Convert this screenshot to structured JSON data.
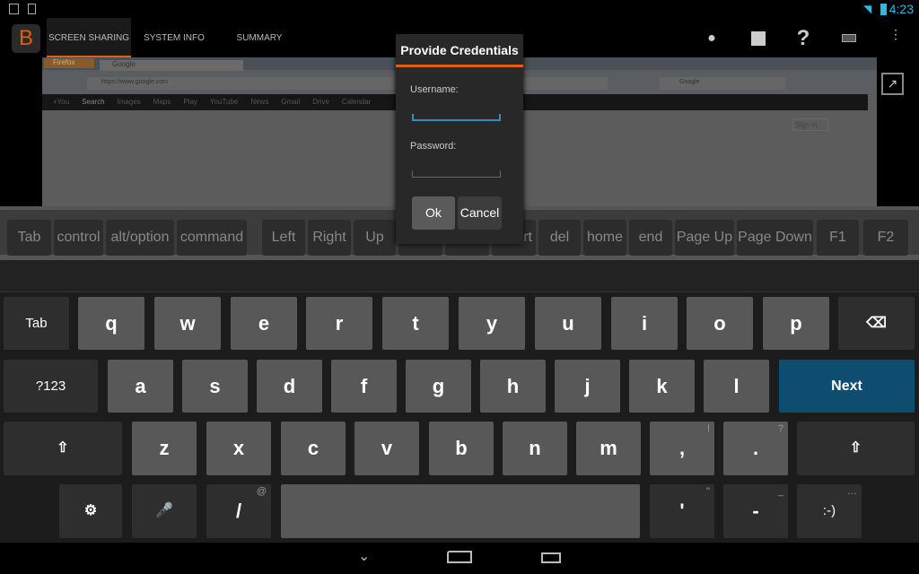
{
  "status_bar": {
    "time": "4:23",
    "icons": [
      "picture-icon",
      "download-icon",
      "wifi-icon",
      "battery-icon"
    ]
  },
  "action_bar": {
    "app_logo": "B",
    "tabs": [
      {
        "label": "SCREEN SHARING",
        "active": true
      },
      {
        "label": "SYSTEM INFO",
        "active": false
      },
      {
        "label": "SUMMARY",
        "active": false
      }
    ],
    "actions": [
      "chat-icon",
      "stop-icon",
      "help-icon",
      "keyboard-icon",
      "overflow-menu-icon"
    ]
  },
  "remote_screen": {
    "browser_button": "Firefox",
    "tab_title": "Google",
    "url": "https://www.google.com",
    "search_placeholder": "Google",
    "nav_links": [
      "+You",
      "Search",
      "Images",
      "Maps",
      "Play",
      "YouTube",
      "News",
      "Gmail",
      "Drive",
      "Calendar"
    ],
    "sign_in": "Sign in"
  },
  "extra_keys": [
    "Tab",
    "control",
    "alt/option",
    "command",
    "Left",
    "Right",
    "Up",
    "",
    "",
    "rt",
    "del",
    "home",
    "end",
    "Page Up",
    "Page Down",
    "F1",
    "F2"
  ],
  "dialog": {
    "title": "Provide Credentials",
    "username_label": "Username:",
    "username_value": "",
    "password_label": "Password:",
    "password_value": "",
    "ok": "Ok",
    "cancel": "Cancel"
  },
  "keyboard": {
    "rows": [
      [
        {
          "l": "Tab",
          "t": "dark"
        },
        {
          "l": "q"
        },
        {
          "l": "w"
        },
        {
          "l": "e"
        },
        {
          "l": "r"
        },
        {
          "l": "t"
        },
        {
          "l": "y"
        },
        {
          "l": "u"
        },
        {
          "l": "i"
        },
        {
          "l": "o"
        },
        {
          "l": "p"
        },
        {
          "l": "⌫",
          "t": "dark",
          "n": "backspace"
        }
      ],
      [
        {
          "l": "?123",
          "t": "dark"
        },
        {
          "l": "a"
        },
        {
          "l": "s"
        },
        {
          "l": "d"
        },
        {
          "l": "f"
        },
        {
          "l": "g"
        },
        {
          "l": "h"
        },
        {
          "l": "j"
        },
        {
          "l": "k"
        },
        {
          "l": "l"
        },
        {
          "l": "Next",
          "t": "accent"
        }
      ],
      [
        {
          "l": "⇧",
          "t": "dark",
          "n": "shift"
        },
        {
          "l": "z"
        },
        {
          "l": "x"
        },
        {
          "l": "c"
        },
        {
          "l": "v"
        },
        {
          "l": "b"
        },
        {
          "l": "n"
        },
        {
          "l": "m"
        },
        {
          "l": ",",
          "h": "!"
        },
        {
          "l": ".",
          "h": "?"
        },
        {
          "l": "⇧",
          "t": "dark",
          "n": "shift"
        }
      ],
      [
        {
          "l": "⚙",
          "t": "dark",
          "n": "settings"
        },
        {
          "l": "🎤",
          "t": "dark",
          "n": "mic"
        },
        {
          "l": "/",
          "t": "dark",
          "h": "@"
        },
        {
          "l": "",
          "n": "space"
        },
        {
          "l": "'",
          "t": "dark",
          "h": "\""
        },
        {
          "l": "-",
          "t": "dark",
          "h": "_"
        },
        {
          "l": ":-)",
          "t": "dark",
          "h": "…"
        }
      ]
    ],
    "accent_color": "#0e4d70"
  },
  "nav_bar": [
    "back-icon",
    "home-icon",
    "recents-icon"
  ]
}
